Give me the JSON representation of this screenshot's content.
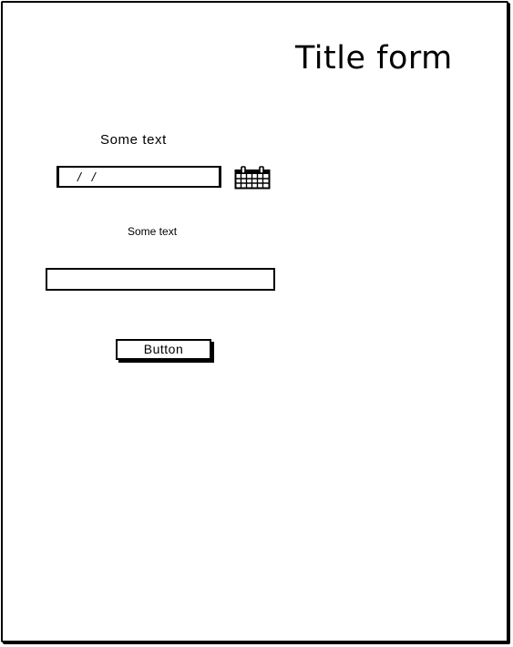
{
  "form": {
    "title": "Title form",
    "date_label": "Some text",
    "date_value": "/ /",
    "text_label": "Some text",
    "text_value": "",
    "button_label": "Button"
  },
  "icons": {
    "calendar": "calendar-icon"
  }
}
